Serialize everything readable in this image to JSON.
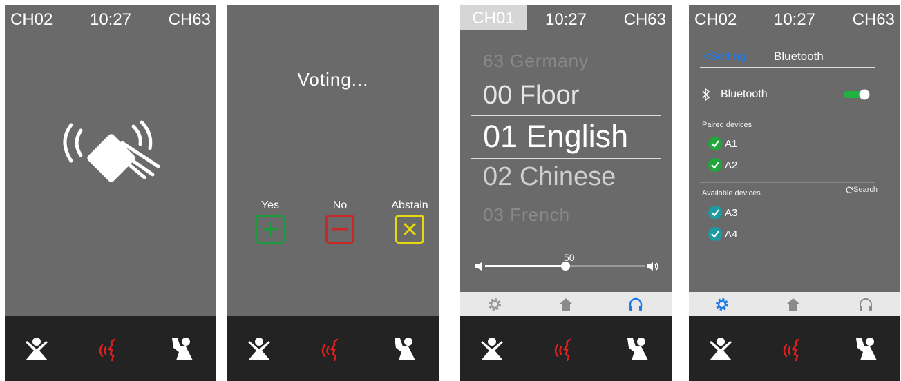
{
  "colors": {
    "screen_bg": "#6a6a6a",
    "nav_bg": "#232323",
    "accent_blue": "#1f7ae8",
    "speak_red": "#e02020",
    "yes_green": "#1a9c3c",
    "no_red": "#c82828",
    "abstain_yellow": "#e8d810",
    "check_green": "#22a63c",
    "check_teal": "#1e9aa0"
  },
  "screen1": {
    "status": {
      "left": "CH02",
      "time": "10:27",
      "right": "CH63"
    }
  },
  "screen2": {
    "voting_text": "Voting...",
    "buttons": [
      {
        "label": "Yes",
        "icon": "plus-icon"
      },
      {
        "label": "No",
        "icon": "minus-icon"
      },
      {
        "label": "Abstain",
        "icon": "x-icon"
      }
    ]
  },
  "screen3": {
    "status": {
      "left": "CH01",
      "time": "10:27",
      "right": "CH63"
    },
    "languages": [
      "63 Germany",
      "00 Floor",
      "01 English",
      "02 Chinese",
      "03 French"
    ],
    "volume": {
      "value": "50",
      "level": 0.5
    }
  },
  "screen4": {
    "status": {
      "left": "CH02",
      "time": "10:27",
      "right": "CH63"
    },
    "back_label": "<Setting",
    "title": "Bluetooth",
    "bluetooth_label": "Bluetooth",
    "bluetooth_on": true,
    "paired_header": "Paired devices",
    "paired": [
      "A1",
      "A2"
    ],
    "available_header": "Available devices",
    "search_label": "Search",
    "available": [
      "A3",
      "A4"
    ]
  }
}
